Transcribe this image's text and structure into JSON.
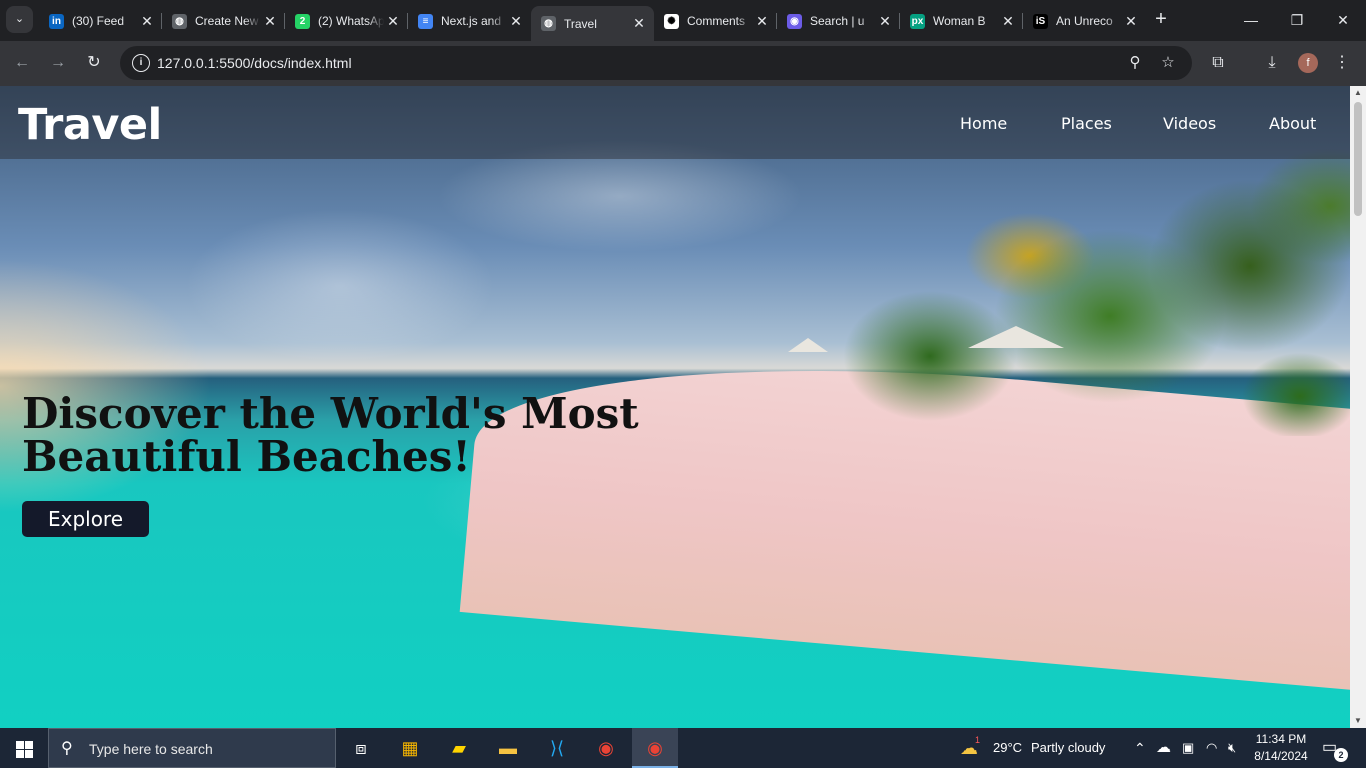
{
  "browser": {
    "tabs": [
      {
        "title": "(30) Feed",
        "favicon": "linkedin-icon",
        "color": "#0a66c2",
        "glyph": "in"
      },
      {
        "title": "Create New",
        "favicon": "globe-icon",
        "color": "#5f6368",
        "glyph": "◍"
      },
      {
        "title": "(2) WhatsApp",
        "favicon": "whatsapp-icon",
        "color": "#25d366",
        "glyph": "2"
      },
      {
        "title": "Next.js and",
        "favicon": "docs-icon",
        "color": "#4285f4",
        "glyph": "≡"
      },
      {
        "title": "Travel",
        "favicon": "globe-icon",
        "color": "#5f6368",
        "glyph": "◍",
        "active": true
      },
      {
        "title": "Comments",
        "favicon": "chatgpt-icon",
        "color": "#ffffff",
        "glyph": "✺"
      },
      {
        "title": "Search | u",
        "favicon": "search-app-icon",
        "color": "#6c5ce7",
        "glyph": "◉"
      },
      {
        "title": "Woman B",
        "favicon": "pexels-icon",
        "color": "#05a081",
        "glyph": "px"
      },
      {
        "title": "An Unreco",
        "favicon": "is-icon",
        "color": "#000000",
        "glyph": "iS"
      }
    ],
    "address": "127.0.0.1:5500/docs/index.html",
    "profile_initial": "f"
  },
  "site": {
    "brand": "Travel",
    "nav": [
      "Home",
      "Places",
      "Videos",
      "About"
    ],
    "headline": "Discover the World's Most Beautiful Beaches!",
    "cta": "Explore"
  },
  "taskbar": {
    "search_placeholder": "Type here to search",
    "weather": {
      "temp": "29°C",
      "desc": "Partly cloudy",
      "badge": "1"
    },
    "time": "11:34 PM",
    "date": "8/14/2024",
    "notifications": "2"
  }
}
